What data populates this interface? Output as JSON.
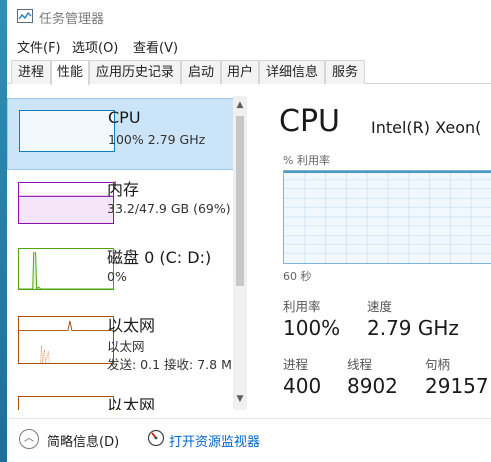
{
  "window": {
    "title": "任务管理器"
  },
  "menu": [
    "文件(F)",
    "选项(O)",
    "查看(V)"
  ],
  "tabs": [
    "进程",
    "性能",
    "应用历史记录",
    "启动",
    "用户",
    "详细信息",
    "服务"
  ],
  "active_tab": "性能",
  "resources": [
    {
      "name": "CPU",
      "value": "100% 2.79 GHz",
      "selected": true,
      "color": "#117dbb"
    },
    {
      "name": "内存",
      "value": "33.2/47.9 GB (69%)",
      "selected": false,
      "color": "#8b12ae"
    },
    {
      "name": "磁盘 0 (C: D:)",
      "value": "0%",
      "selected": false,
      "color": "#4da60c"
    },
    {
      "name": "以太网",
      "value": "以太网",
      "value2": "发送: 0.1 接收: 7.8 M",
      "selected": false,
      "color": "#a74f01"
    },
    {
      "name": "以太网",
      "selected": false,
      "color": "#a74f01"
    }
  ],
  "detail": {
    "title": "CPU",
    "processor": "Intel(R) Xeon(",
    "util_label": "% 利用率",
    "time_label": "60 秒",
    "stats": {
      "util_label": "利用率",
      "util_value": "100%",
      "speed_label": "速度",
      "speed_value": "2.79 GHz",
      "proc_label": "进程",
      "proc_value": "400",
      "thread_label": "线程",
      "thread_value": "8902",
      "handle_label": "句柄",
      "handle_value": "29157"
    },
    "graph_color": "#117dbb"
  },
  "footer": {
    "summary": "简略信息(D)",
    "monitor": "打开资源监视器"
  }
}
